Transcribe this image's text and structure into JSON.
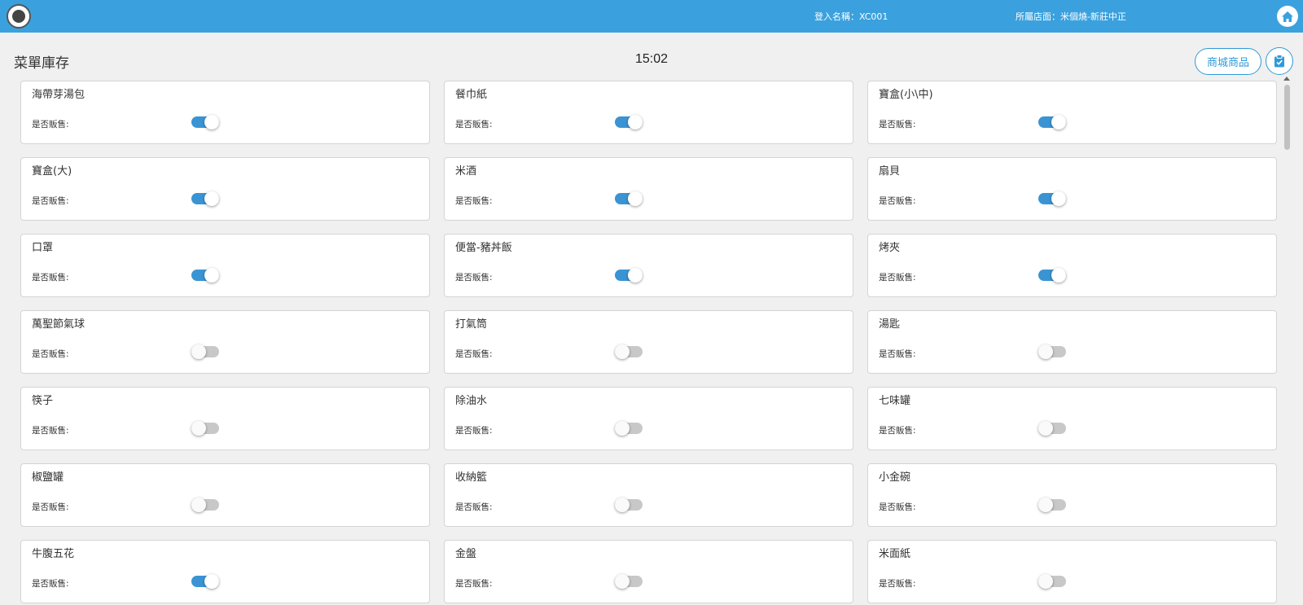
{
  "header": {
    "user_label": "登入名稱：XC001",
    "store_label": "所屬店面：米個燒-新莊中正"
  },
  "page": {
    "title": "菜單庫存",
    "time": "15:02",
    "mall_button": "商城商品"
  },
  "sale_label": "是否販售:",
  "colors": {
    "topbar": "#3aa1de",
    "accent": "#2e9ad8",
    "toggle_on": "#3a94d3"
  },
  "items": [
    {
      "name": "海帶芽湯包",
      "sale_label": "是否販售:",
      "on_sale": true
    },
    {
      "name": "餐巾紙",
      "sale_label": "是否販售:",
      "on_sale": true
    },
    {
      "name": "寶盒(小\\中)",
      "sale_label": "是否販售:",
      "on_sale": true
    },
    {
      "name": "寶盒(大)",
      "sale_label": "是否販售:",
      "on_sale": true
    },
    {
      "name": "米酒",
      "sale_label": "是否販售:",
      "on_sale": true
    },
    {
      "name": "扇貝",
      "sale_label": "是否販售:",
      "on_sale": true
    },
    {
      "name": "口罩",
      "sale_label": "是否販售:",
      "on_sale": true
    },
    {
      "name": "便當-豬丼飯",
      "sale_label": "是否販售:",
      "on_sale": true
    },
    {
      "name": "烤夾",
      "sale_label": "是否販售:",
      "on_sale": true
    },
    {
      "name": "萬聖節氣球",
      "sale_label": "是否販售:",
      "on_sale": false
    },
    {
      "name": "打氣筒",
      "sale_label": "是否販售:",
      "on_sale": false
    },
    {
      "name": "湯匙",
      "sale_label": "是否販售:",
      "on_sale": false
    },
    {
      "name": "筷子",
      "sale_label": "是否販售:",
      "on_sale": false
    },
    {
      "name": "除油水",
      "sale_label": "是否販售:",
      "on_sale": false
    },
    {
      "name": "七味罐",
      "sale_label": "是否販售:",
      "on_sale": false
    },
    {
      "name": "椒鹽罐",
      "sale_label": "是否販售:",
      "on_sale": false
    },
    {
      "name": "收納籃",
      "sale_label": "是否販售:",
      "on_sale": false
    },
    {
      "name": "小金碗",
      "sale_label": "是否販售:",
      "on_sale": false
    },
    {
      "name": "牛腹五花",
      "sale_label": "是否販售:",
      "on_sale": true
    },
    {
      "name": "金盤",
      "sale_label": "是否販售:",
      "on_sale": false
    },
    {
      "name": "米面紙",
      "sale_label": "是否販售:",
      "on_sale": false
    }
  ]
}
